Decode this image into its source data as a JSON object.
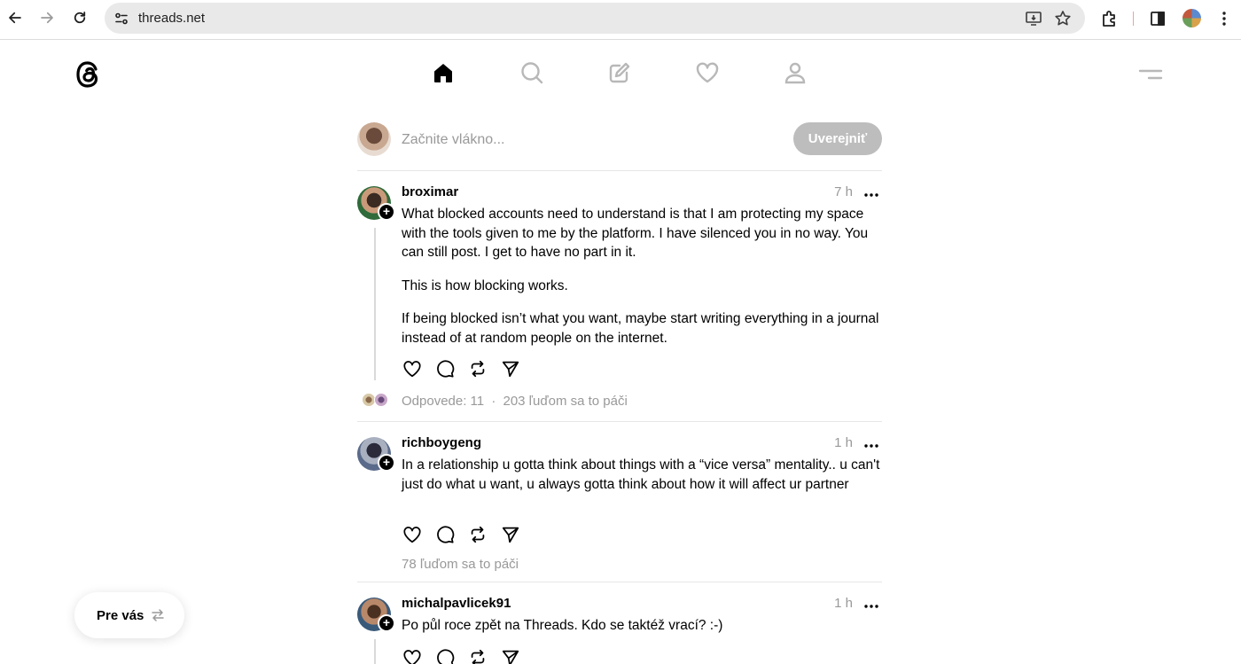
{
  "browser": {
    "url": "threads.net"
  },
  "header": {
    "nav": [
      "home-icon",
      "search-icon",
      "compose-icon",
      "heart-icon",
      "profile-icon"
    ]
  },
  "composer": {
    "placeholder": "Začnite vlákno...",
    "post_label": "Uverejniť"
  },
  "posts": [
    {
      "username": "broximar",
      "time": "7 h",
      "paragraphs": [
        "What blocked accounts need to understand is that I am protecting my space with the tools given to me by the platform. I have silenced you in no way. You can still post. I get to have no part in it.",
        "This is how blocking works.",
        "If being blocked isn’t what you want, maybe start writing everything in a journal instead of at random people on the internet."
      ],
      "replies": "Odpovede: 11",
      "separator": "·",
      "likes": "203 ľuďom sa to páči"
    },
    {
      "username": "richboygeng",
      "time": "1 h",
      "paragraphs": [
        "In a relationship u gotta think about things with a “vice versa” mentality.. u can't just do what u want, u always gotta think about how it will affect ur partner"
      ],
      "likes": "78 ľuďom sa to páči"
    },
    {
      "username": "michalpavlicek91",
      "time": "1 h",
      "paragraphs": [
        "Po půl roce zpět na Threads. Kdo se taktéž vrací? :-)"
      ]
    }
  ],
  "feed_toggle": {
    "label": "Pre vás"
  }
}
